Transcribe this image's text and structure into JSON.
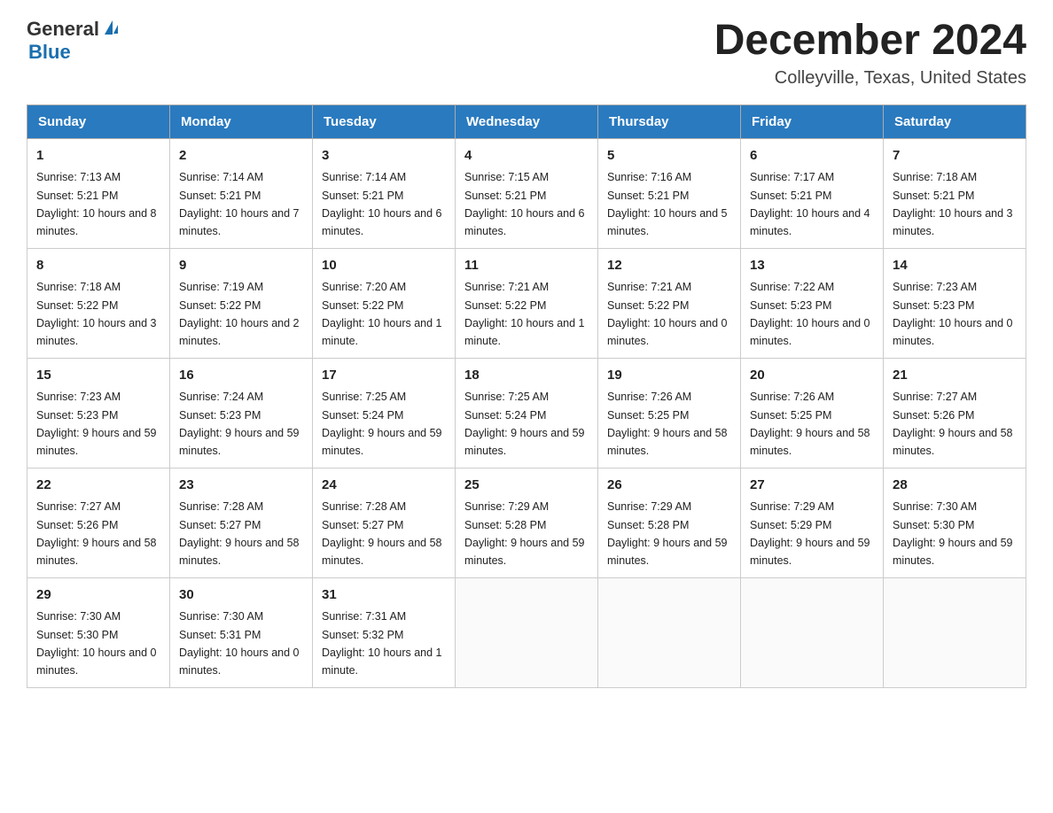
{
  "logo": {
    "text_general": "General",
    "text_blue": "Blue"
  },
  "header": {
    "month": "December 2024",
    "location": "Colleyville, Texas, United States"
  },
  "days_of_week": [
    "Sunday",
    "Monday",
    "Tuesday",
    "Wednesday",
    "Thursday",
    "Friday",
    "Saturday"
  ],
  "weeks": [
    [
      {
        "day": "1",
        "sunrise": "7:13 AM",
        "sunset": "5:21 PM",
        "daylight": "10 hours and 8 minutes."
      },
      {
        "day": "2",
        "sunrise": "7:14 AM",
        "sunset": "5:21 PM",
        "daylight": "10 hours and 7 minutes."
      },
      {
        "day": "3",
        "sunrise": "7:14 AM",
        "sunset": "5:21 PM",
        "daylight": "10 hours and 6 minutes."
      },
      {
        "day": "4",
        "sunrise": "7:15 AM",
        "sunset": "5:21 PM",
        "daylight": "10 hours and 6 minutes."
      },
      {
        "day": "5",
        "sunrise": "7:16 AM",
        "sunset": "5:21 PM",
        "daylight": "10 hours and 5 minutes."
      },
      {
        "day": "6",
        "sunrise": "7:17 AM",
        "sunset": "5:21 PM",
        "daylight": "10 hours and 4 minutes."
      },
      {
        "day": "7",
        "sunrise": "7:18 AM",
        "sunset": "5:21 PM",
        "daylight": "10 hours and 3 minutes."
      }
    ],
    [
      {
        "day": "8",
        "sunrise": "7:18 AM",
        "sunset": "5:22 PM",
        "daylight": "10 hours and 3 minutes."
      },
      {
        "day": "9",
        "sunrise": "7:19 AM",
        "sunset": "5:22 PM",
        "daylight": "10 hours and 2 minutes."
      },
      {
        "day": "10",
        "sunrise": "7:20 AM",
        "sunset": "5:22 PM",
        "daylight": "10 hours and 1 minute."
      },
      {
        "day": "11",
        "sunrise": "7:21 AM",
        "sunset": "5:22 PM",
        "daylight": "10 hours and 1 minute."
      },
      {
        "day": "12",
        "sunrise": "7:21 AM",
        "sunset": "5:22 PM",
        "daylight": "10 hours and 0 minutes."
      },
      {
        "day": "13",
        "sunrise": "7:22 AM",
        "sunset": "5:23 PM",
        "daylight": "10 hours and 0 minutes."
      },
      {
        "day": "14",
        "sunrise": "7:23 AM",
        "sunset": "5:23 PM",
        "daylight": "10 hours and 0 minutes."
      }
    ],
    [
      {
        "day": "15",
        "sunrise": "7:23 AM",
        "sunset": "5:23 PM",
        "daylight": "9 hours and 59 minutes."
      },
      {
        "day": "16",
        "sunrise": "7:24 AM",
        "sunset": "5:23 PM",
        "daylight": "9 hours and 59 minutes."
      },
      {
        "day": "17",
        "sunrise": "7:25 AM",
        "sunset": "5:24 PM",
        "daylight": "9 hours and 59 minutes."
      },
      {
        "day": "18",
        "sunrise": "7:25 AM",
        "sunset": "5:24 PM",
        "daylight": "9 hours and 59 minutes."
      },
      {
        "day": "19",
        "sunrise": "7:26 AM",
        "sunset": "5:25 PM",
        "daylight": "9 hours and 58 minutes."
      },
      {
        "day": "20",
        "sunrise": "7:26 AM",
        "sunset": "5:25 PM",
        "daylight": "9 hours and 58 minutes."
      },
      {
        "day": "21",
        "sunrise": "7:27 AM",
        "sunset": "5:26 PM",
        "daylight": "9 hours and 58 minutes."
      }
    ],
    [
      {
        "day": "22",
        "sunrise": "7:27 AM",
        "sunset": "5:26 PM",
        "daylight": "9 hours and 58 minutes."
      },
      {
        "day": "23",
        "sunrise": "7:28 AM",
        "sunset": "5:27 PM",
        "daylight": "9 hours and 58 minutes."
      },
      {
        "day": "24",
        "sunrise": "7:28 AM",
        "sunset": "5:27 PM",
        "daylight": "9 hours and 58 minutes."
      },
      {
        "day": "25",
        "sunrise": "7:29 AM",
        "sunset": "5:28 PM",
        "daylight": "9 hours and 59 minutes."
      },
      {
        "day": "26",
        "sunrise": "7:29 AM",
        "sunset": "5:28 PM",
        "daylight": "9 hours and 59 minutes."
      },
      {
        "day": "27",
        "sunrise": "7:29 AM",
        "sunset": "5:29 PM",
        "daylight": "9 hours and 59 minutes."
      },
      {
        "day": "28",
        "sunrise": "7:30 AM",
        "sunset": "5:30 PM",
        "daylight": "9 hours and 59 minutes."
      }
    ],
    [
      {
        "day": "29",
        "sunrise": "7:30 AM",
        "sunset": "5:30 PM",
        "daylight": "10 hours and 0 minutes."
      },
      {
        "day": "30",
        "sunrise": "7:30 AM",
        "sunset": "5:31 PM",
        "daylight": "10 hours and 0 minutes."
      },
      {
        "day": "31",
        "sunrise": "7:31 AM",
        "sunset": "5:32 PM",
        "daylight": "10 hours and 1 minute."
      },
      null,
      null,
      null,
      null
    ]
  ],
  "labels": {
    "sunrise": "Sunrise:",
    "sunset": "Sunset:",
    "daylight": "Daylight:"
  }
}
